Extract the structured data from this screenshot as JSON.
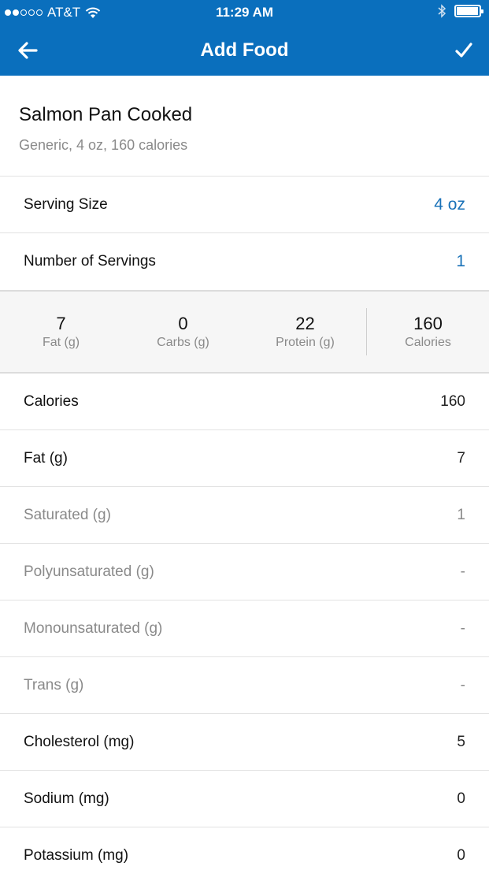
{
  "status_bar": {
    "carrier": "AT&T",
    "time": "11:29 AM"
  },
  "nav": {
    "title": "Add Food"
  },
  "food": {
    "name": "Salmon Pan Cooked",
    "description": "Generic, 4 oz, 160 calories"
  },
  "serving": {
    "size_label": "Serving Size",
    "size_value": "4 oz",
    "servings_label": "Number of Servings",
    "servings_value": "1"
  },
  "macros": [
    {
      "value": "7",
      "label": "Fat (g)"
    },
    {
      "value": "0",
      "label": "Carbs (g)"
    },
    {
      "value": "22",
      "label": "Protein (g)"
    },
    {
      "value": "160",
      "label": "Calories"
    }
  ],
  "nutrition": [
    {
      "label": "Calories",
      "value": "160"
    },
    {
      "label": "Fat (g)",
      "value": "7"
    },
    {
      "label": "Saturated (g)",
      "value": "1"
    },
    {
      "label": "Polyunsaturated (g)",
      "value": "-"
    },
    {
      "label": "Monounsaturated (g)",
      "value": "-"
    },
    {
      "label": "Trans (g)",
      "value": "-"
    },
    {
      "label": "Cholesterol (mg)",
      "value": "5"
    },
    {
      "label": "Sodium (mg)",
      "value": "0"
    },
    {
      "label": "Potassium (mg)",
      "value": "0"
    }
  ],
  "colors": {
    "brand": "#0a6fbd",
    "accent_link": "#1a72b8"
  }
}
